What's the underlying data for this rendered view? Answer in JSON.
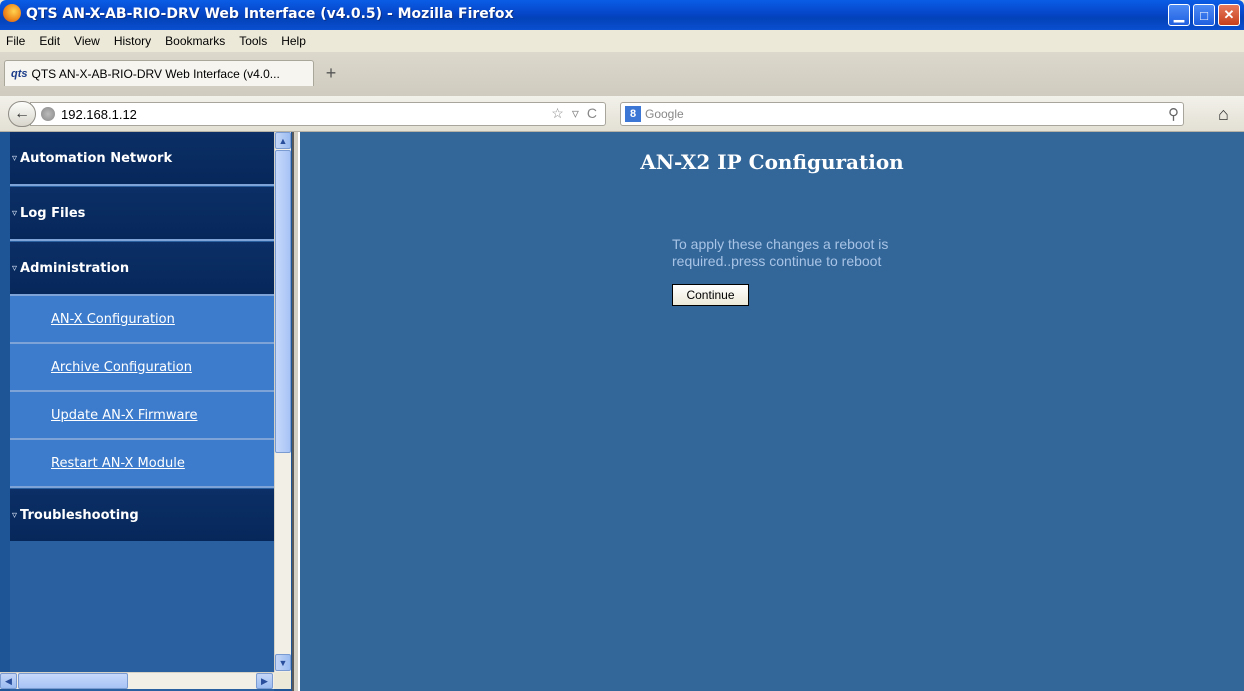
{
  "window": {
    "title": "QTS AN-X-AB-RIO-DRV Web Interface (v4.0.5) - Mozilla Firefox",
    "minimize_glyph": "▁",
    "maximize_glyph": "□",
    "close_glyph": "✕"
  },
  "menubar": {
    "items": [
      "File",
      "Edit",
      "View",
      "History",
      "Bookmarks",
      "Tools",
      "Help"
    ]
  },
  "tab": {
    "logo_text": "qts",
    "label": "QTS AN-X-AB-RIO-DRV Web Interface (v4.0...",
    "new_tab_glyph": "+"
  },
  "navbar": {
    "back_glyph": "←",
    "url": "192.168.1.12",
    "star_glyph": "☆",
    "dropdown_glyph": "▿",
    "reload_glyph": "C",
    "search_engine_glyph": "8",
    "search_placeholder": "Google",
    "search_glyph": "⚲",
    "home_glyph": "⌂"
  },
  "sidebar": {
    "tri_glyph": "▿",
    "sections": [
      {
        "label": "Automation Network"
      },
      {
        "label": "Log Files"
      },
      {
        "label": "Administration"
      },
      {
        "label": "Troubleshooting"
      }
    ],
    "admin_items": [
      {
        "label": "AN-X Configuration"
      },
      {
        "label": "Archive Configuration"
      },
      {
        "label": "Update AN-X Firmware"
      },
      {
        "label": "Restart AN-X Module"
      }
    ],
    "scroll": {
      "up": "▲",
      "down": "▼",
      "left": "◀",
      "right": "▶"
    }
  },
  "main": {
    "heading": "AN-X2 IP Configuration",
    "message_line1": "To apply these changes a reboot is",
    "message_line2": "required..press continue to reboot",
    "continue_label": "Continue"
  },
  "colors": {
    "main_bg": "#336699",
    "section_bg": "#06275a",
    "item_bg": "#3d7ccc",
    "message_text": "#a8c4e6"
  }
}
